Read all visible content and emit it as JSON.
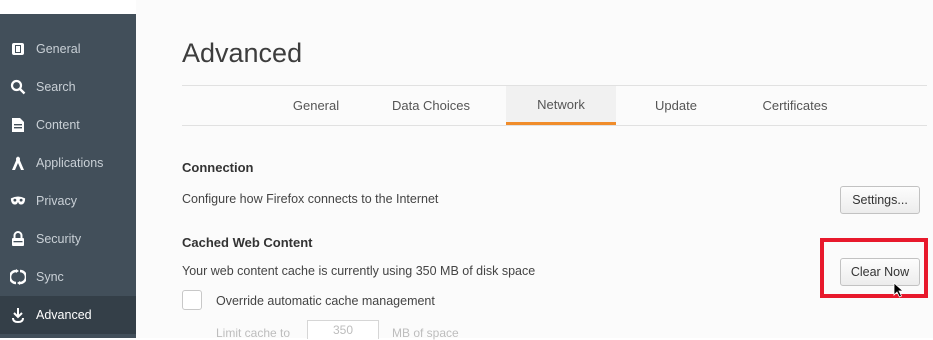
{
  "sidebar": {
    "items": [
      {
        "label": "General",
        "icon": "general-icon"
      },
      {
        "label": "Search",
        "icon": "search-icon"
      },
      {
        "label": "Content",
        "icon": "content-icon"
      },
      {
        "label": "Applications",
        "icon": "applications-icon"
      },
      {
        "label": "Privacy",
        "icon": "privacy-icon"
      },
      {
        "label": "Security",
        "icon": "security-lock-icon"
      },
      {
        "label": "Sync",
        "icon": "sync-icon"
      },
      {
        "label": "Advanced",
        "icon": "advanced-icon"
      }
    ],
    "active": "Advanced"
  },
  "main": {
    "title": "Advanced",
    "tabs": [
      {
        "label": "General"
      },
      {
        "label": "Data Choices"
      },
      {
        "label": "Network"
      },
      {
        "label": "Update"
      },
      {
        "label": "Certificates"
      }
    ],
    "selected_tab": "Network",
    "connection": {
      "title": "Connection",
      "description": "Configure how Firefox connects to the Internet",
      "button": "Settings..."
    },
    "cache": {
      "title": "Cached Web Content",
      "description": "Your web content cache is currently using 350 MB of disk space",
      "button": "Clear Now",
      "override_label": "Override automatic cache management",
      "override_checked": false,
      "limit_label": "Limit cache to",
      "limit_value": "350",
      "limit_unit": "MB of space"
    }
  },
  "colors": {
    "sidebar_bg": "#424f5a",
    "accent_tab": "#f08c2a",
    "highlight": "#e8192c"
  }
}
